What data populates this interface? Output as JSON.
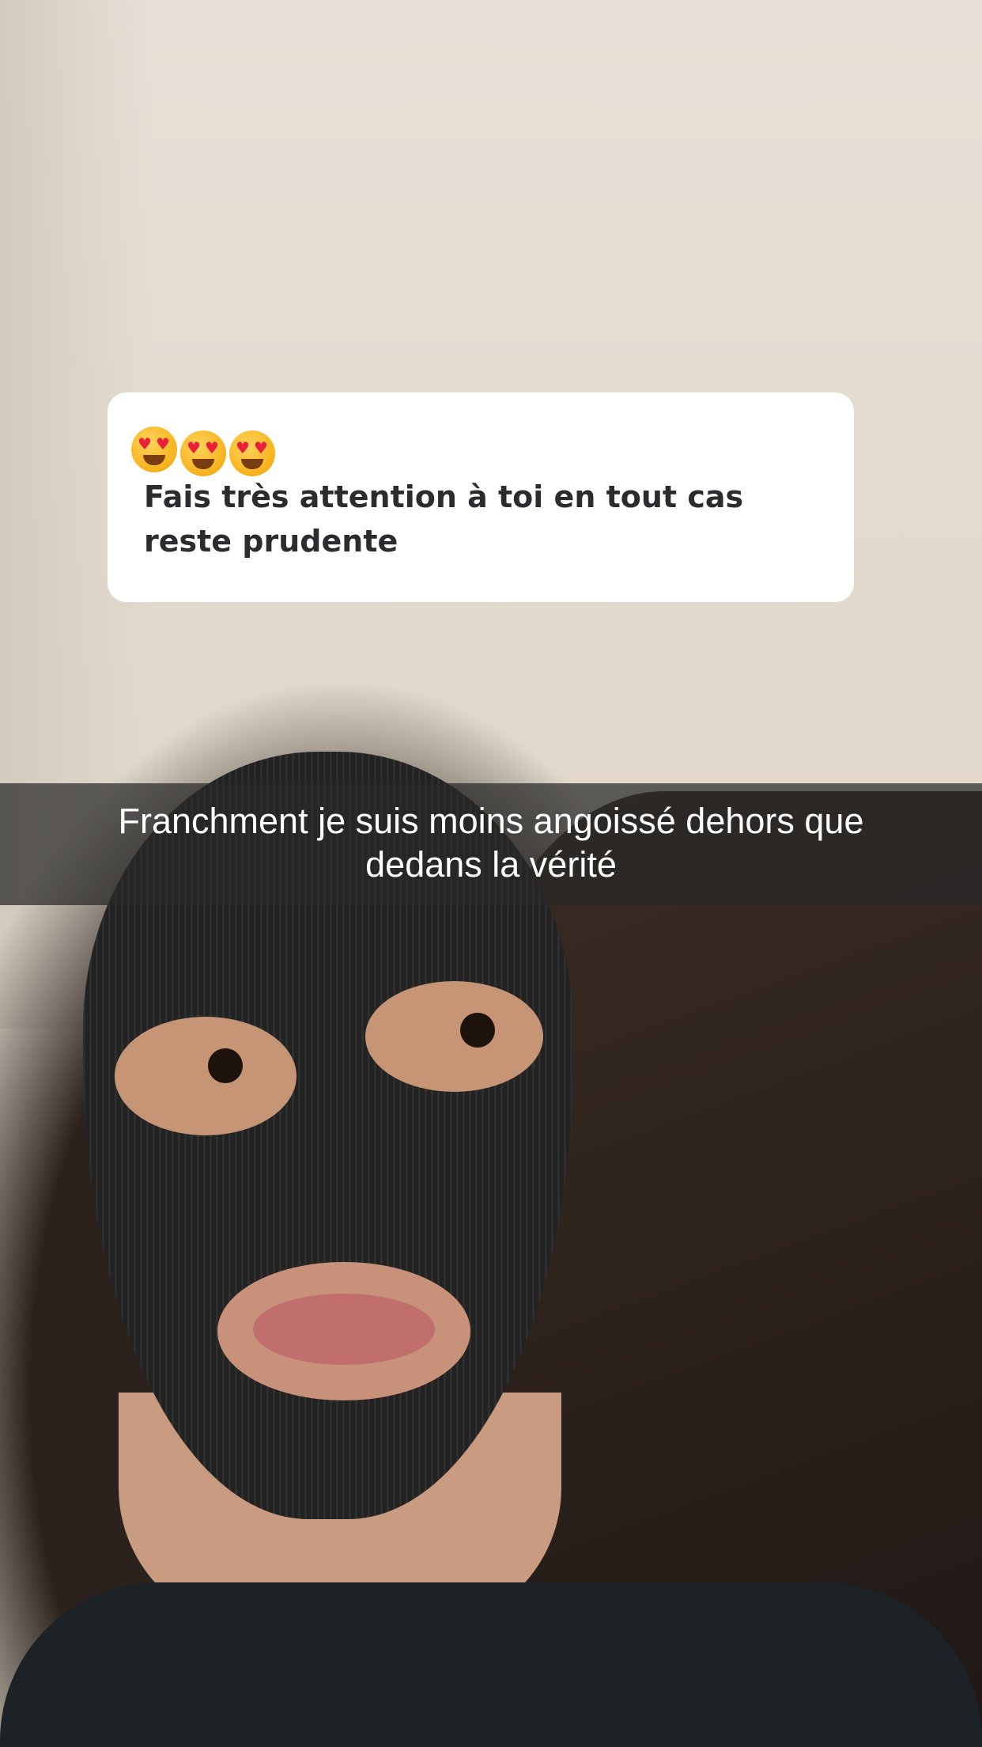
{
  "question_card": {
    "emojis": [
      "heart-eyes-emoji",
      "heart-eyes-emoji",
      "heart-eyes-emoji"
    ],
    "text": "Fais très attention à toi en tout cas reste prudente"
  },
  "caption": {
    "text": "Franchment je suis moins angoissé dehors que dedans la vérité"
  },
  "colors": {
    "card_background": "#ffffff",
    "card_text": "#2b2c30",
    "caption_bar": "#282828",
    "caption_text": "#ffffff"
  }
}
